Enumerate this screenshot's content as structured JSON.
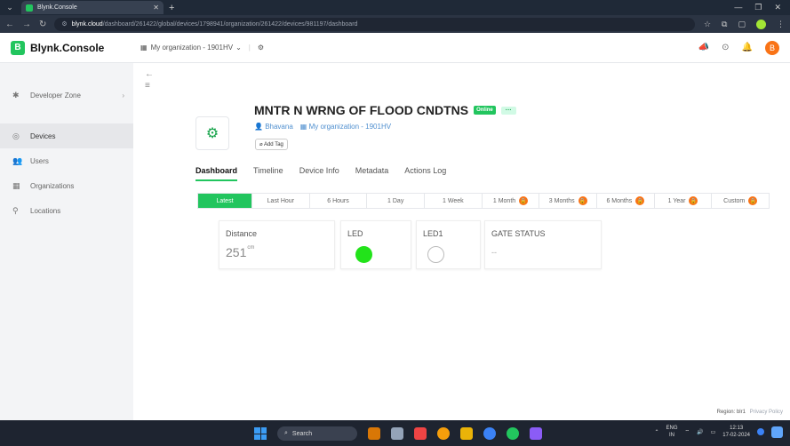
{
  "browser": {
    "tab_title": "Blynk.Console",
    "url_host": "blynk.cloud",
    "url_path": "/dashboard/261422/global/devices/1798941/organization/261422/devices/981197/dashboard"
  },
  "header": {
    "brand": "Blynk.Console",
    "brand_letter": "B",
    "org_name": "My organization - 1901HV",
    "avatar_letter": "B"
  },
  "sidebar": {
    "items": [
      {
        "label": "Developer Zone",
        "icon": "developer-icon"
      },
      {
        "label": "Devices",
        "icon": "devices-icon"
      },
      {
        "label": "Users",
        "icon": "users-icon"
      },
      {
        "label": "Organizations",
        "icon": "organizations-icon"
      },
      {
        "label": "Locations",
        "icon": "locations-icon"
      }
    ]
  },
  "device": {
    "title": "MNTR N WRNG OF FLOOD CNDTNS",
    "status": "Online",
    "more": "···",
    "owner": "Bhavana",
    "org": "My organization - 1901HV",
    "add_tag": "Add Tag"
  },
  "tabs": [
    "Dashboard",
    "Timeline",
    "Device Info",
    "Metadata",
    "Actions Log"
  ],
  "time_ranges": [
    "Latest",
    "Last Hour",
    "6 Hours",
    "1 Day",
    "1 Week",
    "1 Month",
    "3 Months",
    "6 Months",
    "1 Year",
    "Custom"
  ],
  "widgets": {
    "distance": {
      "title": "Distance",
      "value": "251",
      "unit": "cm"
    },
    "led": {
      "title": "LED",
      "color": "#22e31a"
    },
    "led1": {
      "title": "LED1"
    },
    "gate": {
      "title": "GATE STATUS",
      "value": "--"
    }
  },
  "footer": {
    "region": "Region: blr1",
    "privacy": "Privacy Policy"
  },
  "taskbar": {
    "search": "Search",
    "lang_top": "ENG",
    "lang_bottom": "IN",
    "time": "12:13",
    "date": "17-02-2024"
  }
}
